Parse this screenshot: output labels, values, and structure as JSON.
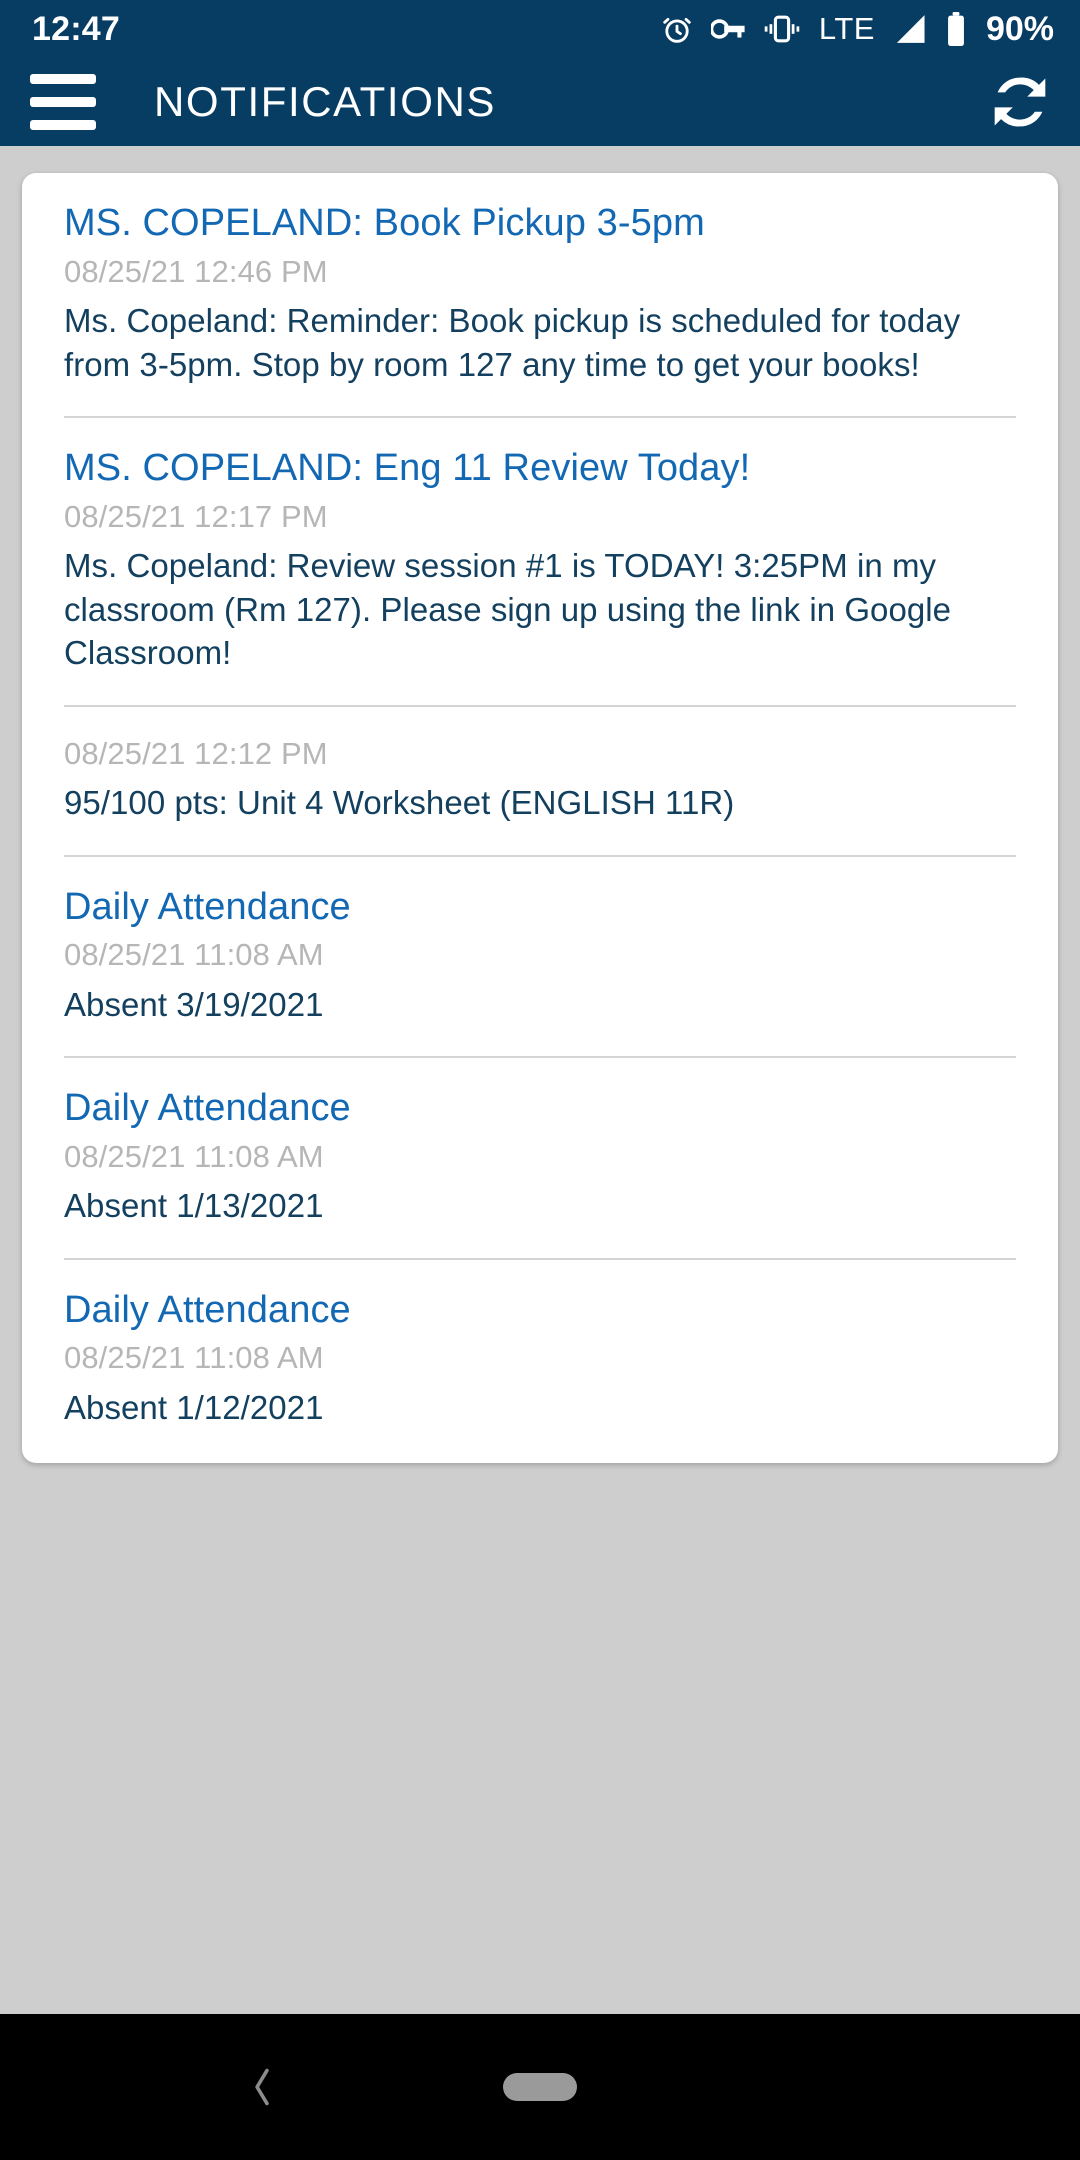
{
  "status_bar": {
    "time": "12:47",
    "battery_percent": "90%",
    "network_type": "LTE",
    "icons": [
      "alarm-icon",
      "vpn-key-icon",
      "vibrate-icon",
      "lte-label",
      "signal-icon",
      "battery-icon"
    ],
    "background_color": "#073c63",
    "foreground_color": "#ffffff"
  },
  "app_bar": {
    "title": "NOTIFICATIONS",
    "menu_icon": "hamburger-menu-icon",
    "refresh_icon": "refresh-sync-icon",
    "background_color": "#073c63"
  },
  "colors": {
    "page_background": "#cecece",
    "card_background": "#ffffff",
    "title_link": "#1368b4",
    "timestamp": "#b6b6b6",
    "body_text": "#14405f",
    "divider": "#d4d4d4"
  },
  "notifications": [
    {
      "title": "MS. COPELAND: Book Pickup 3-5pm",
      "timestamp": "08/25/21 12:46 PM",
      "body": "Ms. Copeland: Reminder: Book pickup is scheduled for today from 3-5pm. Stop by room 127 any time to get your books!"
    },
    {
      "title": "MS. COPELAND: Eng 11 Review Today!",
      "timestamp": "08/25/21 12:17 PM",
      "body": "Ms. Copeland: Review session #1 is TODAY! 3:25PM in my classroom (Rm 127). Please sign up using the link in Google Classroom!"
    },
    {
      "title": "",
      "timestamp": "08/25/21 12:12 PM",
      "body": "95/100 pts: Unit 4 Worksheet (ENGLISH 11R)"
    },
    {
      "title": "Daily Attendance",
      "timestamp": "08/25/21 11:08 AM",
      "body": "Absent 3/19/2021"
    },
    {
      "title": "Daily Attendance",
      "timestamp": "08/25/21 11:08 AM",
      "body": "Absent 1/13/2021"
    },
    {
      "title": "Daily Attendance",
      "timestamp": "08/25/21 11:08 AM",
      "body": "Absent 1/12/2021"
    }
  ],
  "nav_bar": {
    "back_icon": "back-chevron-icon",
    "home_indicator": "home-pill-indicator",
    "background_color": "#000000"
  }
}
